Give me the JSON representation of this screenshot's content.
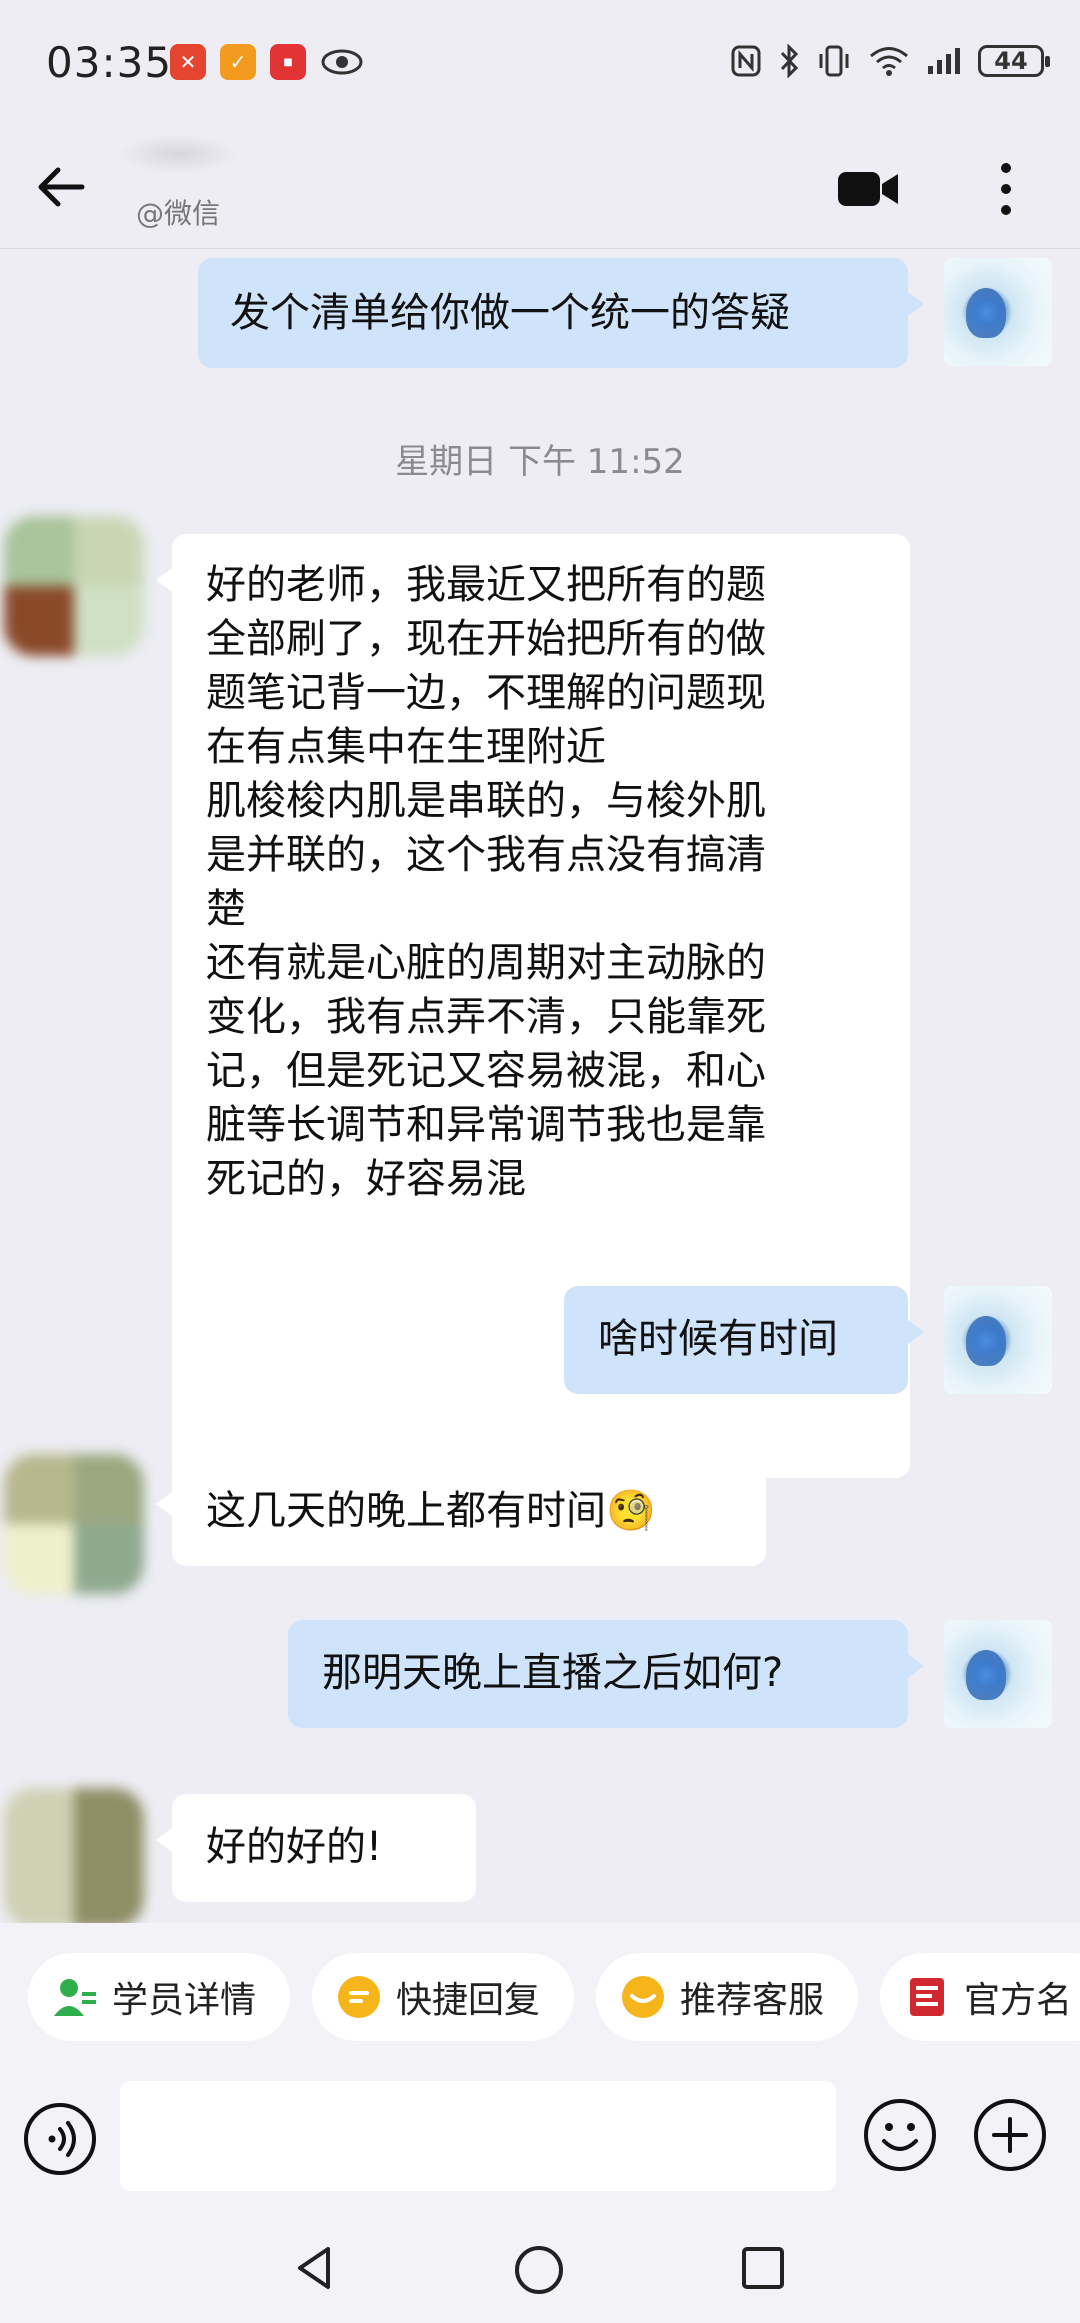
{
  "status_bar": {
    "time": "03:35",
    "battery": "44",
    "icons": [
      "red-app-icon",
      "orange-app-icon",
      "red-app-icon",
      "eye-icon",
      "nfc-icon",
      "bluetooth-icon",
      "vibrate-icon",
      "wifi-icon",
      "signal-icon",
      "battery-icon"
    ]
  },
  "header": {
    "subtitle": "@微信",
    "icons": [
      "back-arrow-icon",
      "video-call-icon",
      "more-icon"
    ]
  },
  "chat": {
    "timestamp": "星期日  下午 11:52",
    "messages": [
      {
        "from": "me",
        "lines": [
          "发个清单给你做一个统一的答疑"
        ]
      },
      {
        "from": "them",
        "lines": [
          "好的老师，我最近又把所有的题",
          "全部刷了，现在开始把所有的做",
          "题笔记背一边，不理解的问题现",
          "在有点集中在生理附近",
          "肌梭梭内肌是串联的，与梭外肌",
          "是并联的，这个我有点没有搞清",
          "楚",
          "还有就是心脏的周期对主动脉的",
          "变化，我有点弄不清，只能靠死",
          "记，但是死记又容易被混，和心",
          "脏等长调节和异常调节我也是靠",
          "死记的，好容易混"
        ]
      },
      {
        "from": "me",
        "lines": [
          "啥时候有时间"
        ]
      },
      {
        "from": "them",
        "lines": [
          "这几天的晚上都有时间"
        ],
        "emoji": "🧐"
      },
      {
        "from": "me",
        "lines": [
          "那明天晚上直播之后如何?"
        ]
      },
      {
        "from": "them",
        "lines": [
          "好的好的!"
        ]
      }
    ]
  },
  "quick_actions": [
    {
      "label": "学员详情",
      "icon": "student-icon",
      "color": "#2fae4e"
    },
    {
      "label": "快捷回复",
      "icon": "quick-reply-icon",
      "color": "#f5b51b"
    },
    {
      "label": "推荐客服",
      "icon": "service-icon",
      "color": "#f5b51b"
    },
    {
      "label": "官方名",
      "icon": "official-card-icon",
      "color": "#d0282e"
    }
  ],
  "input": {
    "placeholder": "",
    "icons": [
      "voice-icon",
      "emoji-icon",
      "plus-icon"
    ]
  },
  "nav": {
    "icons": [
      "nav-back-icon",
      "nav-home-icon",
      "nav-recent-icon"
    ]
  },
  "colors": {
    "background": "#ededf3",
    "my_bubble": "#cfe4fb",
    "their_bubble": "#ffffff"
  }
}
